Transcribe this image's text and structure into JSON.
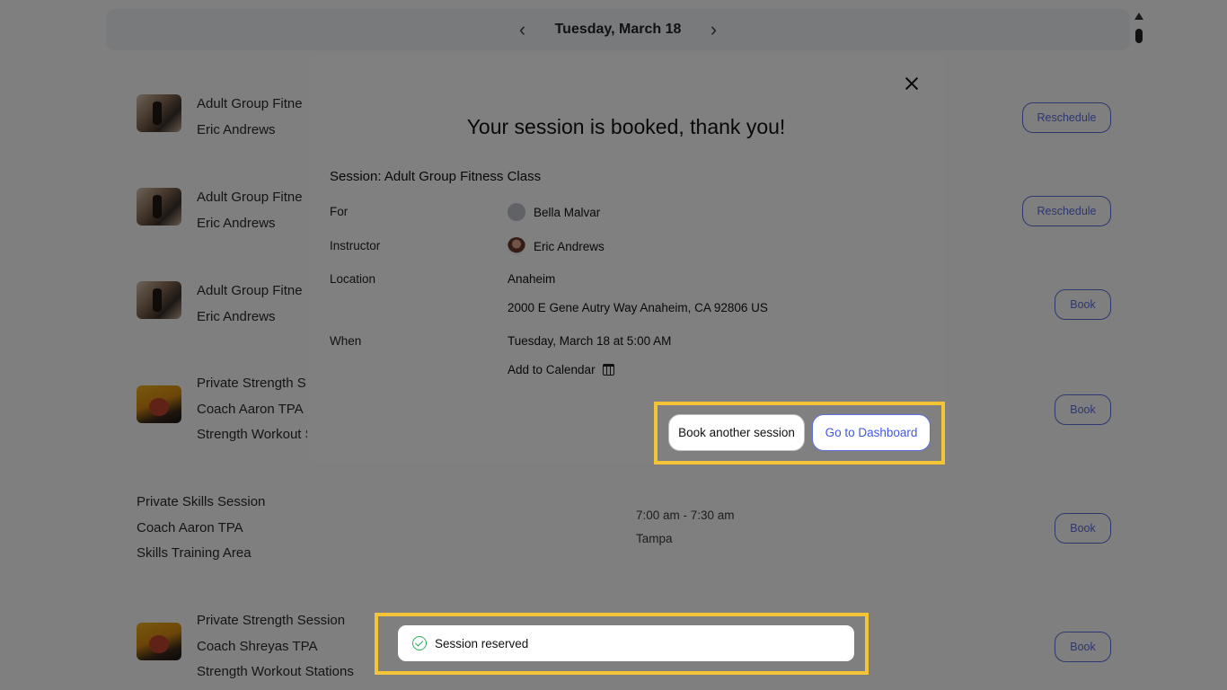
{
  "datebar": {
    "prev": "‹",
    "date": "Tuesday, March 18",
    "next": "›"
  },
  "rows": [
    {
      "lines": [
        "Adult Group Fitne",
        "Eric Andrews"
      ],
      "button": "Reschedule"
    },
    {
      "lines": [
        "Adult Group Fitne",
        "Eric Andrews"
      ],
      "button": "Reschedule"
    },
    {
      "lines": [
        "Adult Group Fitne",
        "Eric Andrews"
      ],
      "button": "Book"
    },
    {
      "lines": [
        "Private Strength S",
        "Coach Aaron TPA",
        "Strength Workout S"
      ],
      "button": "Book"
    },
    {
      "lines": [
        "Private Skills Session",
        "Coach Aaron TPA",
        "Skills Training Area"
      ],
      "time": "7:00 am - 7:30 am",
      "location": "Tampa",
      "button": "Book"
    },
    {
      "lines": [
        "Private Strength Session",
        "Coach Shreyas TPA",
        "Strength Workout Stations"
      ],
      "button": "Book"
    }
  ],
  "modal": {
    "title": "Your session is booked, thank you!",
    "session": "Session: Adult Group Fitness Class",
    "for_label": "For",
    "for_value": "Bella Malvar",
    "instructor_label": "Instructor",
    "instructor_value": "Eric Andrews",
    "location_label": "Location",
    "location_value": "Anaheim",
    "address": "2000 E Gene Autry Way Anaheim, CA 92806 US",
    "when_label": "When",
    "when_value": "Tuesday, March 18 at 5:00 AM",
    "add_calendar": "Add to Calendar",
    "book_another": "Book another session",
    "go_dashboard": "Go to Dashboard"
  },
  "toast": {
    "message": "Session reserved"
  },
  "colors": {
    "highlight": "#f2c436",
    "accent": "#5b6ee1",
    "success": "#2fae60"
  }
}
